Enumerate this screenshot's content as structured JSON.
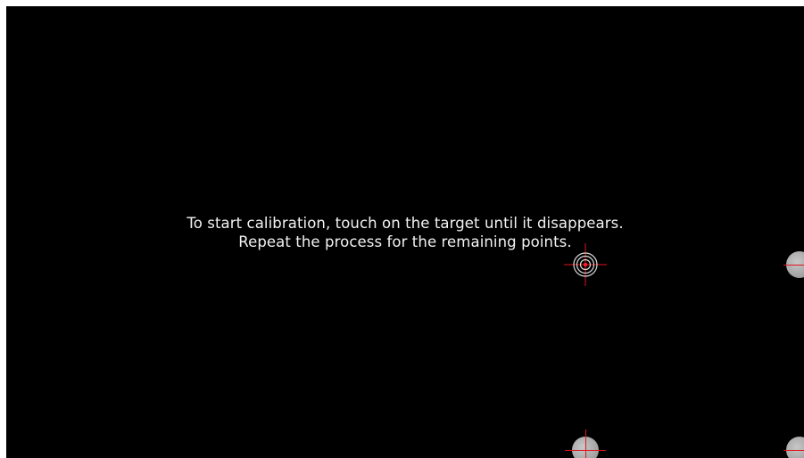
{
  "screen": {
    "background_color": "#000000"
  },
  "instructions": {
    "line1": "To start calibration, touch on the target until it disappears.",
    "line2": "Repeat the process for the remaining points."
  },
  "targets": [
    {
      "name": "active-calibration-target",
      "state": "active",
      "icon": "crosshair-target-icon"
    },
    {
      "name": "calibration-point-right-middle",
      "state": "pending",
      "icon": "calibration-point-icon"
    },
    {
      "name": "calibration-point-bottom-center",
      "state": "pending",
      "icon": "calibration-point-icon"
    },
    {
      "name": "calibration-point-bottom-right",
      "state": "pending",
      "icon": "calibration-point-icon"
    }
  ],
  "colors": {
    "crosshair": "#e0141e",
    "target_ring": "#d9d9d9",
    "pending_point": "#b0b0b0",
    "text": "#f2f2f2"
  }
}
